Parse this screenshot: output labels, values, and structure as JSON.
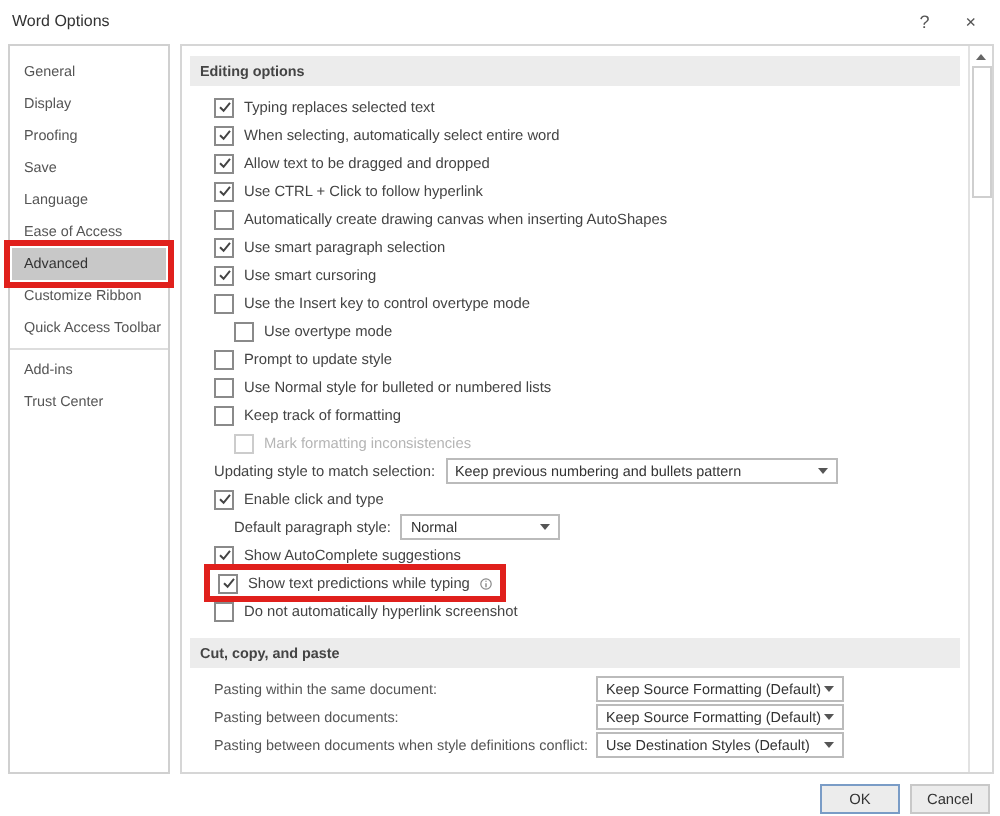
{
  "window": {
    "title": "Word Options",
    "help": "?",
    "close": "×"
  },
  "sidebar": {
    "sections": [
      {
        "items": [
          {
            "label": "General",
            "selected": false,
            "highlighted": false
          },
          {
            "label": "Display",
            "selected": false,
            "highlighted": false
          },
          {
            "label": "Proofing",
            "selected": false,
            "highlighted": false
          },
          {
            "label": "Save",
            "selected": false,
            "highlighted": false
          },
          {
            "label": "Language",
            "selected": false,
            "highlighted": false
          },
          {
            "label": "Ease of Access",
            "selected": false,
            "highlighted": false
          },
          {
            "label": "Advanced",
            "selected": true,
            "highlighted": true
          },
          {
            "label": "Customize Ribbon",
            "selected": false,
            "highlighted": false
          },
          {
            "label": "Quick Access Toolbar",
            "selected": false,
            "highlighted": false
          }
        ]
      },
      {
        "items": [
          {
            "label": "Add-ins",
            "selected": false,
            "highlighted": false
          },
          {
            "label": "Trust Center",
            "selected": false,
            "highlighted": false
          }
        ]
      }
    ]
  },
  "sections": [
    {
      "title": "Editing options",
      "options": [
        {
          "kind": "checkbox",
          "label": "Typing replaces selected text",
          "checked": true,
          "disabled": false,
          "highlighted": false
        },
        {
          "kind": "checkbox",
          "label": "When selecting, automatically select entire word",
          "checked": true,
          "disabled": false,
          "highlighted": false
        },
        {
          "kind": "checkbox",
          "label": "Allow text to be dragged and dropped",
          "checked": true,
          "disabled": false,
          "highlighted": false
        },
        {
          "kind": "checkbox",
          "label": "Use CTRL + Click to follow hyperlink",
          "checked": true,
          "disabled": false,
          "highlighted": false
        },
        {
          "kind": "checkbox",
          "label": "Automatically create drawing canvas when inserting AutoShapes",
          "checked": false,
          "disabled": false,
          "highlighted": false
        },
        {
          "kind": "checkbox",
          "label": "Use smart paragraph selection",
          "checked": true,
          "disabled": false,
          "highlighted": false
        },
        {
          "kind": "checkbox",
          "label": "Use smart cursoring",
          "checked": true,
          "disabled": false,
          "highlighted": false
        },
        {
          "kind": "checkbox",
          "label": "Use the Insert key to control overtype mode",
          "checked": false,
          "disabled": false,
          "highlighted": false,
          "children": [
            {
              "kind": "checkbox",
              "label": "Use overtype mode",
              "checked": false,
              "disabled": false,
              "highlighted": false
            }
          ]
        },
        {
          "kind": "checkbox",
          "label": "Prompt to update style",
          "checked": false,
          "disabled": false,
          "highlighted": false
        },
        {
          "kind": "checkbox",
          "label": "Use Normal style for bulleted or numbered lists",
          "checked": false,
          "disabled": false,
          "highlighted": false
        },
        {
          "kind": "checkbox",
          "label": "Keep track of formatting",
          "checked": false,
          "disabled": false,
          "highlighted": false,
          "children": [
            {
              "kind": "checkbox",
              "label": "Mark formatting inconsistencies",
              "checked": false,
              "disabled": true,
              "highlighted": false
            }
          ]
        },
        {
          "kind": "dropdown",
          "label": "Updating style to match selection:",
          "value": "Keep previous numbering and bullets pattern"
        },
        {
          "kind": "checkbox",
          "label": "Enable click and type",
          "checked": true,
          "disabled": false,
          "highlighted": false,
          "children": [
            {
              "kind": "dropdown",
              "label": "Default paragraph style:",
              "value": "Normal"
            }
          ]
        },
        {
          "kind": "checkbox",
          "label": "Show AutoComplete suggestions",
          "checked": true,
          "disabled": false,
          "highlighted": false
        },
        {
          "kind": "checkbox",
          "label": "Show text predictions while typing",
          "checked": true,
          "disabled": false,
          "highlighted": true,
          "info": true
        },
        {
          "kind": "checkbox",
          "label": "Do not automatically hyperlink screenshot",
          "checked": false,
          "disabled": false,
          "highlighted": false
        }
      ]
    },
    {
      "title": "Cut, copy, and paste",
      "options": [
        {
          "kind": "paste",
          "label": "Pasting within the same document:",
          "value": "Keep Source Formatting (Default)"
        },
        {
          "kind": "paste",
          "label": "Pasting between documents:",
          "value": "Keep Source Formatting (Default)"
        },
        {
          "kind": "paste",
          "label": "Pasting between documents when style definitions conflict:",
          "value": "Use Destination Styles (Default)"
        }
      ]
    }
  ],
  "buttons": [
    {
      "label": "OK",
      "default": true
    },
    {
      "label": "Cancel",
      "default": false
    }
  ]
}
